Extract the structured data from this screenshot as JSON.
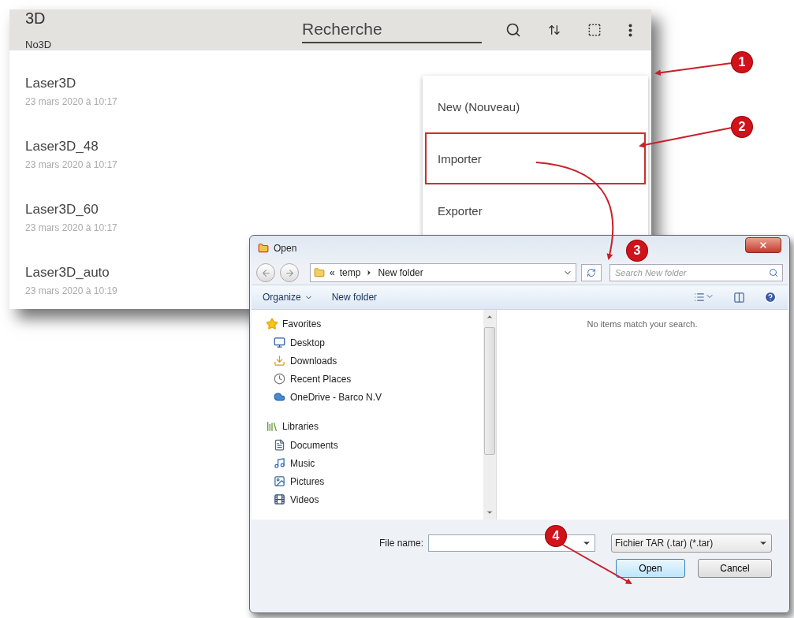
{
  "app": {
    "title": "3D",
    "subtitle": "No3D",
    "search": {
      "placeholder": "Recherche"
    },
    "items": [
      {
        "name": "Laser3D",
        "date": "23 mars 2020 à 10:17"
      },
      {
        "name": "Laser3D_48",
        "date": "23 mars 2020 à 10:17"
      },
      {
        "name": "Laser3D_60",
        "date": "23 mars 2020 à 10:17"
      },
      {
        "name": "Laser3D_auto",
        "date": "23 mars 2020 à 10:19"
      }
    ],
    "menu": [
      {
        "label": "New (Nouveau)",
        "selected": false
      },
      {
        "label": "Importer",
        "selected": true
      },
      {
        "label": "Exporter",
        "selected": false
      }
    ]
  },
  "dialog": {
    "title": "Open",
    "path_prefix": "«",
    "path": [
      "temp",
      "New folder"
    ],
    "search": {
      "placeholder": "Search New folder"
    },
    "toolbar": [
      "Organize",
      "New folder"
    ],
    "nav": [
      {
        "label": "Favorites",
        "kind": "favorites",
        "children": [
          {
            "label": "Desktop",
            "kind": "desktop"
          },
          {
            "label": "Downloads",
            "kind": "downloads"
          },
          {
            "label": "Recent Places",
            "kind": "recent"
          },
          {
            "label": "OneDrive - Barco N.V",
            "kind": "cloud"
          }
        ]
      },
      {
        "label": "Libraries",
        "kind": "libraries",
        "children": [
          {
            "label": "Documents",
            "kind": "documents"
          },
          {
            "label": "Music",
            "kind": "music"
          },
          {
            "label": "Pictures",
            "kind": "pictures"
          },
          {
            "label": "Videos",
            "kind": "videos"
          }
        ]
      }
    ],
    "empty_message": "No items match your search.",
    "file_name_label": "File name:",
    "file_type": "Fichier TAR (.tar) (*.tar)",
    "buttons": [
      {
        "label": "Open",
        "default": true
      },
      {
        "label": "Cancel",
        "default": false
      }
    ]
  },
  "callouts": [
    "1",
    "2",
    "3",
    "4"
  ]
}
